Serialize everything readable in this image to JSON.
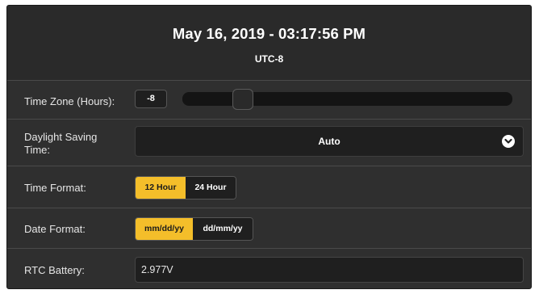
{
  "header": {
    "datetime": "May 16, 2019 - 03:17:56 PM",
    "utc_offset": "UTC-8"
  },
  "time_zone": {
    "label": "Time Zone (Hours):",
    "value": "-8",
    "slider_fraction": 0.125
  },
  "daylight_saving": {
    "label_line1": "Daylight Saving",
    "label_line2": "Time:",
    "selected": "Auto",
    "icon": "chevron-down-icon"
  },
  "time_format": {
    "label": "Time Format:",
    "options": [
      "12 Hour",
      "24 Hour"
    ],
    "selected": "12 Hour"
  },
  "date_format": {
    "label": "Date Format:",
    "options": [
      "mm/dd/yy",
      "dd/mm/yy"
    ],
    "selected": "mm/dd/yy"
  },
  "rtc_battery": {
    "label": "RTC Battery:",
    "value": "2.977V"
  },
  "colors": {
    "panel_bg": "#2f2f2f",
    "accent": "#f4be2a",
    "control_bg": "#1f1f1f"
  }
}
